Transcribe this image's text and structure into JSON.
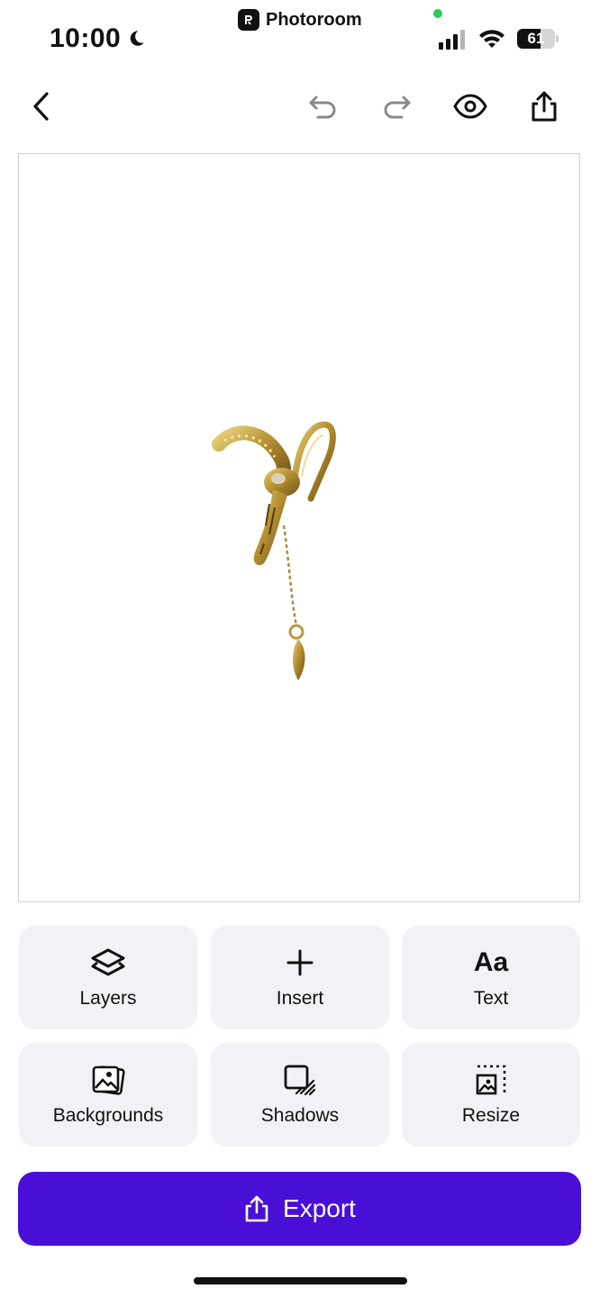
{
  "status_bar": {
    "time": "10:00",
    "app_name": "Photoroom",
    "battery_level": 61,
    "battery_label": "61"
  },
  "toolbar": {
    "icons": [
      "back-chevron-icon",
      "undo-icon",
      "redo-icon",
      "preview-eye-icon",
      "share-icon"
    ]
  },
  "canvas": {
    "subject": "gold earring cuff with chain"
  },
  "tools": [
    {
      "label": "Layers",
      "icon": "layers-icon"
    },
    {
      "label": "Insert",
      "icon": "plus-icon"
    },
    {
      "label": "Text",
      "icon_text": "Aa"
    },
    {
      "label": "Backgrounds",
      "icon": "images-icon"
    },
    {
      "label": "Shadows",
      "icon": "shadow-icon"
    },
    {
      "label": "Resize",
      "icon": "resize-icon"
    }
  ],
  "export": {
    "label": "Export",
    "color": "#4a0fd6"
  }
}
